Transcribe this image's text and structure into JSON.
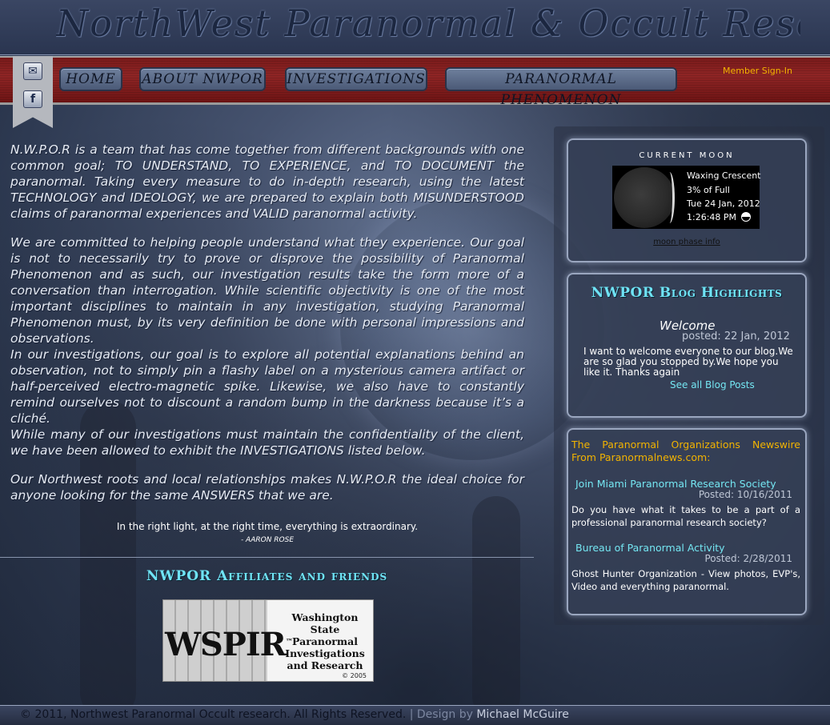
{
  "header": {
    "site_title": "NorthWest Paranormal & Occult Research"
  },
  "nav": {
    "items": [
      "HOME",
      "ABOUT NWPOR",
      "INVESTIGATIONS",
      "PARANORMAL PHENOMENON"
    ],
    "member_signin": "Member Sign-In"
  },
  "social": {
    "email_glyph": "✉",
    "facebook_glyph": "f"
  },
  "main": {
    "paragraphs": [
      "N.W.P.O.R is a team that has come together from different backgrounds with one common goal; TO UNDERSTAND, TO EXPERIENCE, and TO DOCUMENT the paranormal. Taking every measure to do in-depth research, using the latest TECHNOLOGY and IDEOLOGY, we are prepared to explain both MISUNDERSTOOD claims of paranormal experiences and VALID paranormal activity.",
      "We are committed to helping people understand what they experience. Our goal is not to necessarily try to prove or disprove the possibility of Paranormal Phenomenon and as such, our investigation results take the form more of a conversation than interrogation. While scientific objectivity is one of the most important disciplines to maintain in any investigation, studying Paranormal Phenomenon must, by its very definition be done with personal impressions and observations.",
      "In our investigations, our goal is to explore all potential explanations behind an observation, not to simply pin a flashy label on a mysterious camera artifact or half-perceived electro-magnetic spike. Likewise, we also have to constantly remind ourselves not to discount a random bump in the darkness because it’s a cliché.",
      "While many of our investigations must maintain the confidentiality of the client, we have been allowed to exhibit the INVESTIGATIONS listed below.",
      "Our Northwest roots and local relationships makes N.W.P.O.R the ideal choice for anyone looking for the same ANSWERS that we are."
    ],
    "quote": "In the right light, at the right time, everything is extraordinary.",
    "quote_author": "- AARON ROSE"
  },
  "affiliates": {
    "heading": "NWPOR Affiliates and friends",
    "logo_abbr": "WSPIR",
    "logo_tm": "™",
    "logo_full_name": "Washington State Paranormal Investigations and Research",
    "logo_year": "© 2005"
  },
  "moon": {
    "title": "CURRENT MOON",
    "phase": "Waxing Crescent",
    "percent": "3% of Full",
    "date": "Tue 24 Jan, 2012",
    "time": "1:26:48 PM",
    "link": "moon phase info"
  },
  "blog": {
    "heading": "NWPOR Blog Highlights",
    "post_title": "Welcome",
    "post_date": "posted: 22 Jan, 2012",
    "post_body": "I want to welcome everyone to our blog.We are so glad you stopped by.We hope you like it. Thanks again",
    "see_all": "See all Blog Posts"
  },
  "newswire": {
    "heading": "The Paranormal Organizations Newswire From Paranormalnews.com:",
    "items": [
      {
        "title": "Join Miami Paranormal Research Society",
        "date": "Posted: 10/16/2011",
        "desc": "Do you have what it takes to be a part of a professional paranormal research society?"
      },
      {
        "title": "Bureau of Paranormal Activity",
        "date": "Posted: 2/28/2011",
        "desc": "Ghost Hunter Organization - View photos, EVP's, Video and everything paranormal."
      }
    ]
  },
  "footer": {
    "copyright": "© 2011, Northwest Paranormal Occult research. All Rights Reserved.",
    "separator": " | ",
    "design_by": "Design by ",
    "designer": "Michael McGuire"
  },
  "colors": {
    "accent_cyan": "#6fe3f5",
    "accent_gold": "#f2b300",
    "nav_red": "#8f2525"
  }
}
